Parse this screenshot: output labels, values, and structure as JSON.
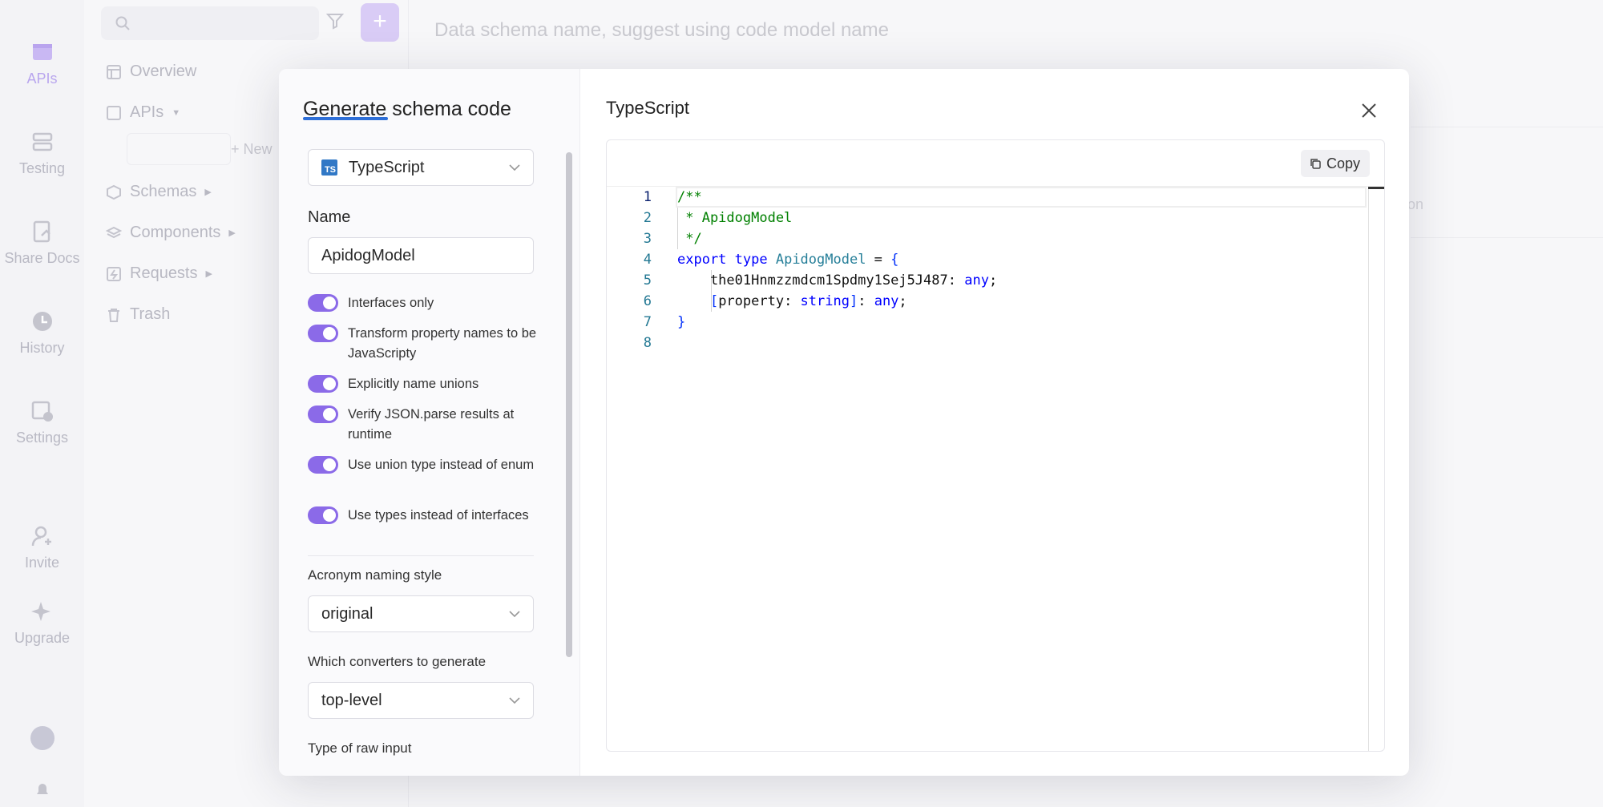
{
  "rail": {
    "items": [
      {
        "label": "APIs",
        "icon": "apis-icon"
      },
      {
        "label": "Testing",
        "icon": "testing-icon"
      },
      {
        "label": "Share Docs",
        "icon": "share-docs-icon"
      },
      {
        "label": "History",
        "icon": "history-icon"
      },
      {
        "label": "Settings",
        "icon": "settings-icon"
      },
      {
        "label": "Invite",
        "icon": "invite-icon"
      },
      {
        "label": "Upgrade",
        "icon": "upgrade-icon"
      }
    ]
  },
  "tree": {
    "items": [
      {
        "label": "Overview"
      },
      {
        "label": "APIs"
      },
      {
        "label": "Schemas"
      },
      {
        "label": "Components"
      },
      {
        "label": "Requests"
      },
      {
        "label": "Trash"
      }
    ],
    "new_label": "+ New"
  },
  "main": {
    "schema_name_placeholder": "Data schema name, suggest using code model name",
    "fragment": "ion"
  },
  "modal": {
    "title_part1": "Generate",
    "title_part2": " schema code",
    "language": "TypeScript",
    "name_label": "Name",
    "name_value": "ApidogModel",
    "toggles": [
      {
        "label": "Interfaces only",
        "on": true
      },
      {
        "label": "Transform property names to be JavaScripty",
        "on": true
      },
      {
        "label": "Explicitly name unions",
        "on": true
      },
      {
        "label": "Verify JSON.parse results at runtime",
        "on": true
      },
      {
        "label": "Use union type instead of enum",
        "on": true
      },
      {
        "label": "Use types instead of interfaces",
        "on": true
      }
    ],
    "acronym_label": "Acronym naming style",
    "acronym_value": "original",
    "converters_label": "Which converters to generate",
    "converters_value": "top-level",
    "raw_input_label": "Type of raw input",
    "code_title": "TypeScript",
    "copy_label": "Copy",
    "line_numbers": [
      "1",
      "2",
      "3",
      "4",
      "5",
      "6",
      "7",
      "8"
    ],
    "code": {
      "l1": "/**",
      "l2": " * ApidogModel",
      "l3": " */",
      "l4_kw1": "export",
      "l4_kw2": " type ",
      "l4_type": "ApidogModel",
      "l4_rest": " = ",
      "l4_brace": "{",
      "l5_prop": "    the01Hnmzzmdcm1Spdmy1Sej5J487: ",
      "l5_type": "any",
      "l5_end": ";",
      "l6_open": "    [",
      "l6_prop": "property: ",
      "l6_type": "string",
      "l6_close": "]",
      "l6_colon": ": ",
      "l6_any": "any",
      "l6_end": ";",
      "l7": "}"
    }
  },
  "colors": {
    "accent": "#8b6ae8",
    "ts_blue": "#3178c6",
    "comment": "#008000",
    "keyword": "#0000ff",
    "type": "#267f99"
  }
}
